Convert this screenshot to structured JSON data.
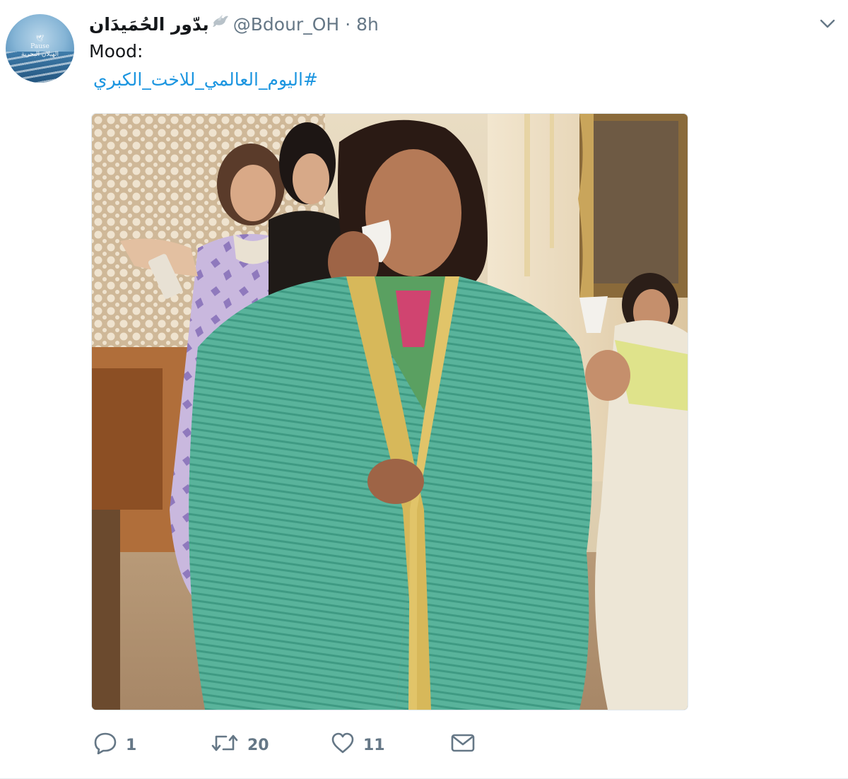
{
  "tweet": {
    "display_name": "بدّور الحُمَيدَان",
    "handle": "@Bdour_OH",
    "separator": "·",
    "time": "8h",
    "text_line1": "Mood:",
    "hashtag": "#اليوم_العالمي_للاخت_الكبري",
    "icons": {
      "avatar": "profile-avatar",
      "name_emoji": "dove-icon",
      "menu": "chevron-down-icon"
    },
    "avatar_text": [
      "🕊",
      "Pause",
      "الهيلان البحرية"
    ],
    "actions": {
      "reply_count": "1",
      "retweet_count": "20",
      "like_count": "11"
    },
    "colors": {
      "link": "#1b95e0",
      "muted": "#657786",
      "text": "#14171a"
    }
  }
}
